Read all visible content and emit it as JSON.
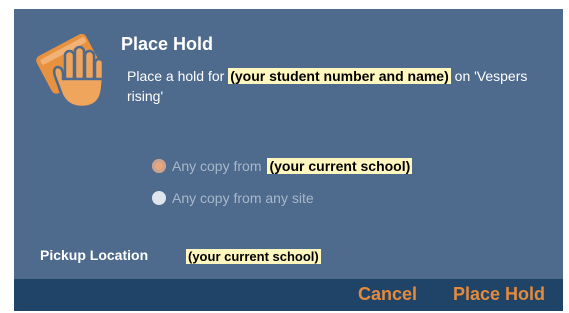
{
  "dialog": {
    "title": "Place Hold",
    "message": {
      "prefix": "Place a hold for",
      "patron_placeholder": "(your student number and name)",
      "suffix": "on 'Vespers rising'"
    },
    "icon": "book-with-hand-icon",
    "options": [
      {
        "label": "Any copy from",
        "value": "(your current school)",
        "selected": true
      },
      {
        "label": "Any copy from any site",
        "selected": false
      }
    ],
    "pickup": {
      "label": "Pickup Location",
      "value": "(your current school)"
    },
    "buttons": {
      "cancel": "Cancel",
      "place_hold": "Place Hold"
    }
  },
  "colors": {
    "dialog_background": "#4e6a8c",
    "footer_background": "#1f4468",
    "accent": "#e48a3b",
    "highlight": "#fff7bd"
  }
}
